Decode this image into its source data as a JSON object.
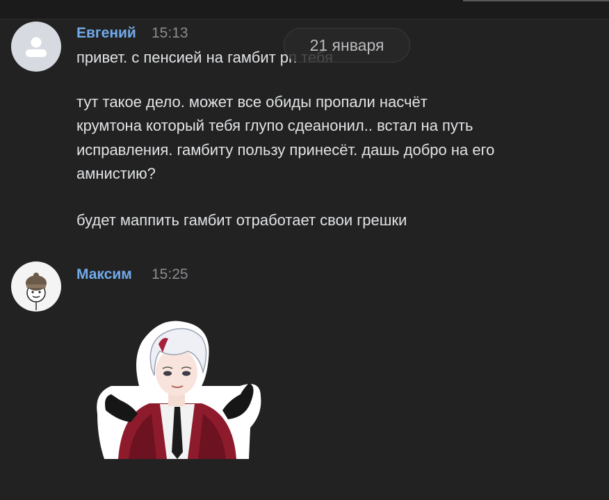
{
  "messages": [
    {
      "author": "Евгений",
      "time": "15:13",
      "lines": [
        "привет. с пенсией на гамбит рп тебя",
        "тут такое дело. может все обиды пропали насчёт",
        "крумтона который тебя глупо сдеанонил.. встал на путь",
        "исправления. гамбиту пользу принесёт. дашь добро на его",
        "амнистию?",
        "будет маппить гамбит отработает свои грешки"
      ]
    },
    {
      "author": "Максим",
      "time": "15:25",
      "sticker": "anime-character-shrug-sticker"
    }
  ],
  "date_separator": "21 января",
  "colors": {
    "background": "#222222",
    "author": "#71aaeb",
    "text": "#e1e3e6",
    "time": "#8a8c90"
  }
}
